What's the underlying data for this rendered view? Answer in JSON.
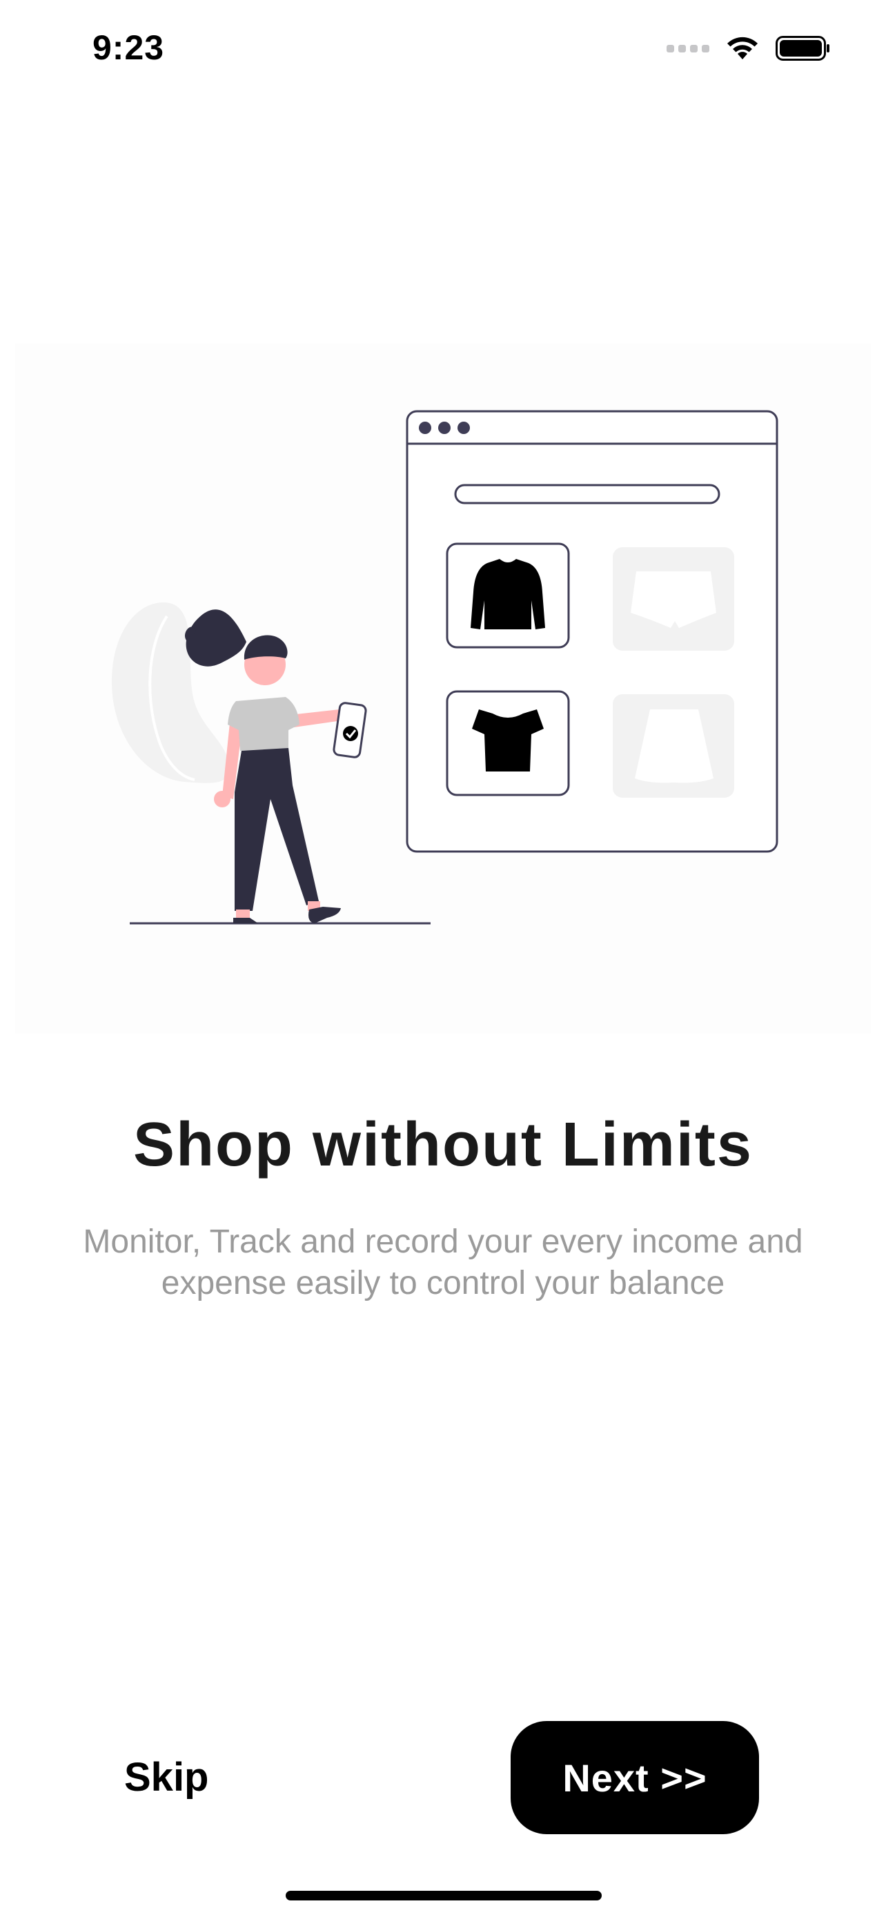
{
  "status_bar": {
    "time": "9:23"
  },
  "onboarding": {
    "headline": "Shop without Limits",
    "subtitle": "Monitor, Track and record your every income and expense easily to control your balance"
  },
  "actions": {
    "skip_label": "Skip",
    "next_label": "Next >>"
  },
  "colors": {
    "accent": "#000000",
    "background": "#ffffff",
    "subtitle_text": "#9a9a9a",
    "figure_dark": "#2f2e41",
    "figure_skin": "#ffb6b6",
    "light_gray": "#f2f2f2"
  }
}
